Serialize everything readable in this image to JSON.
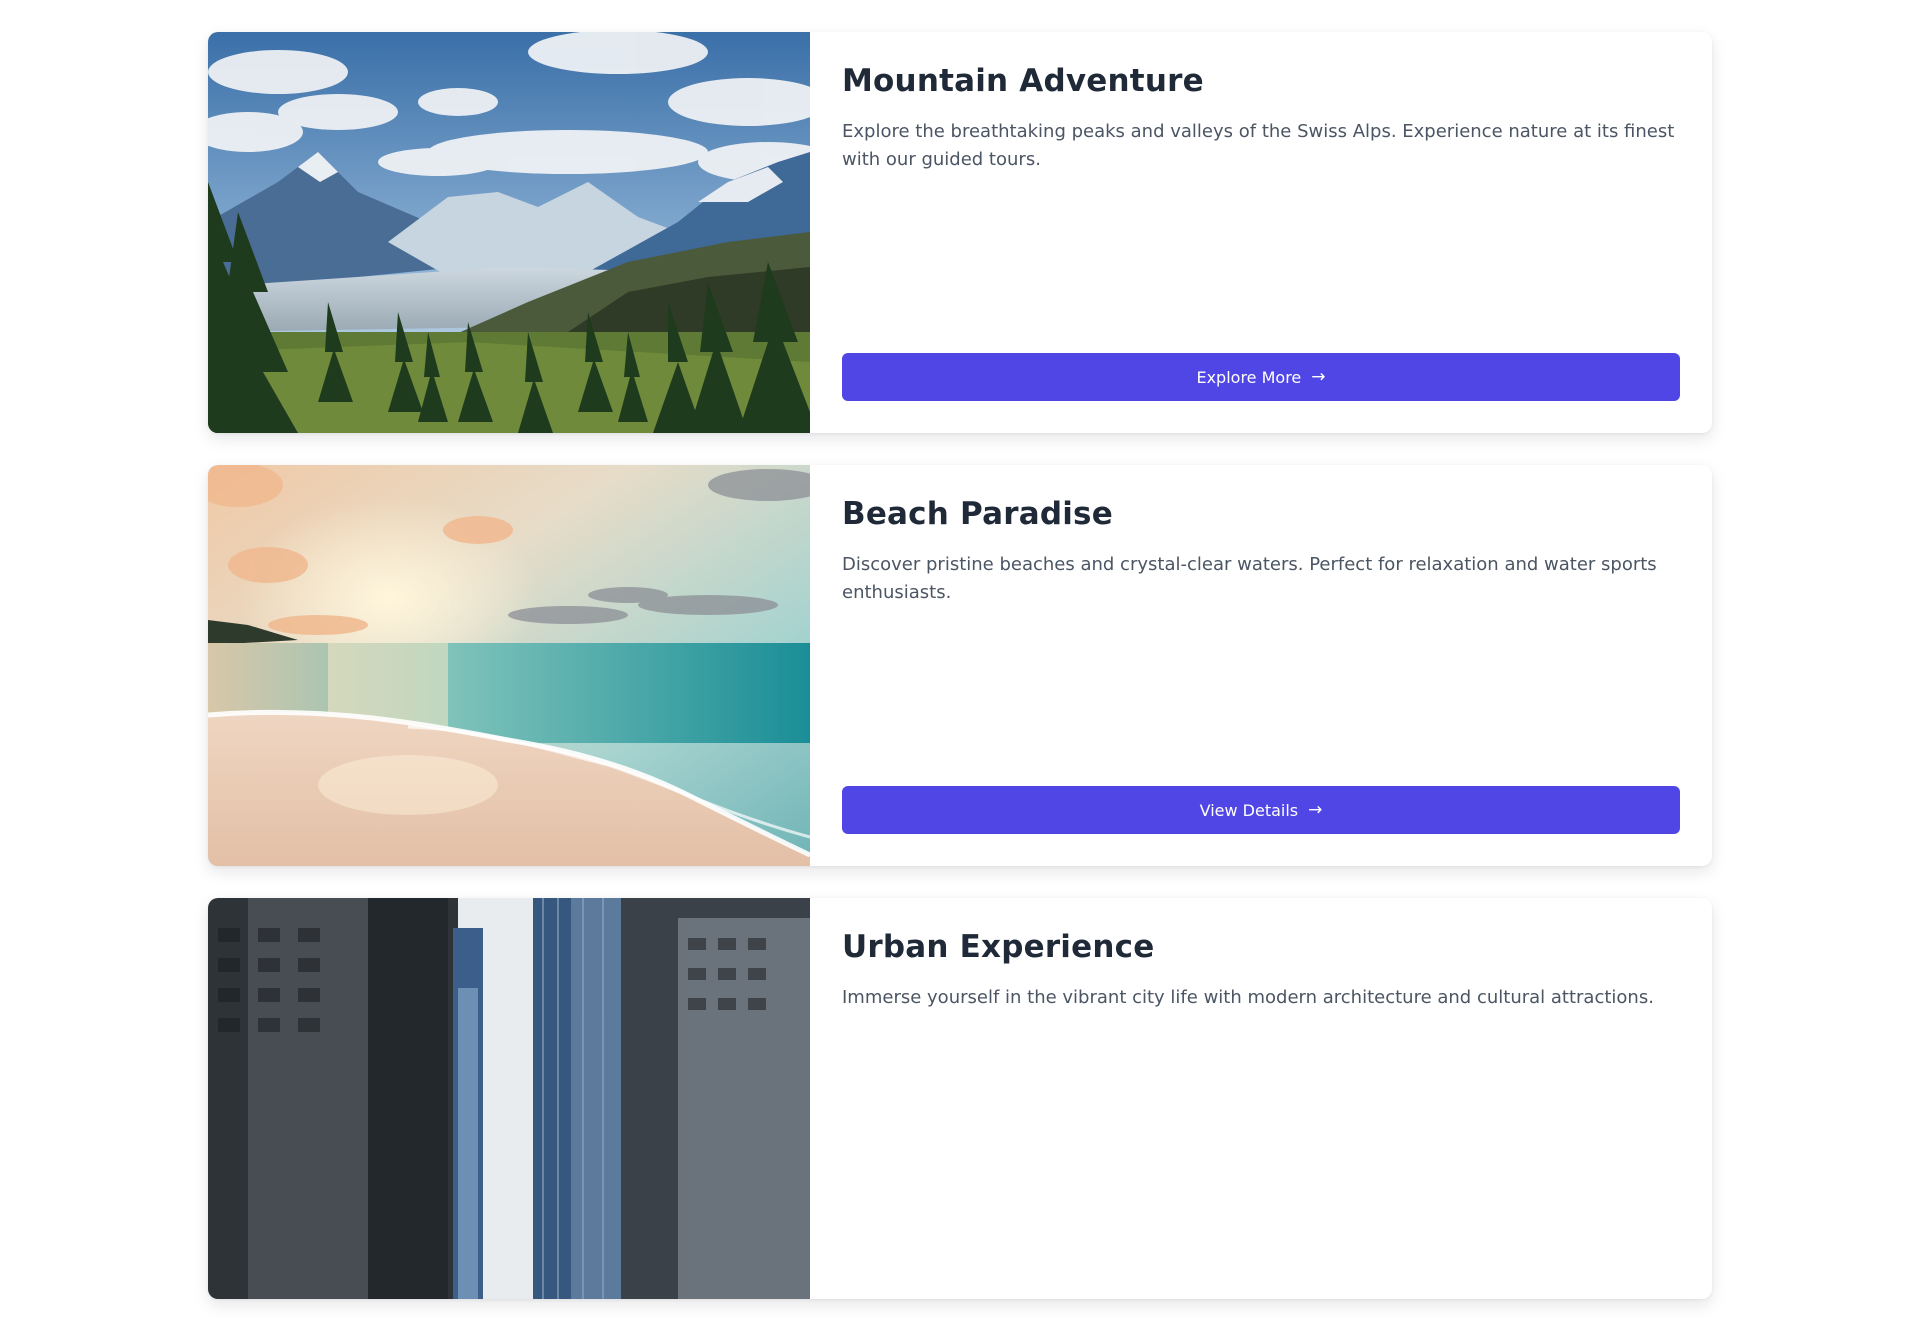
{
  "cards": [
    {
      "title": "Mountain Adventure",
      "description": "Explore the breathtaking peaks and valleys of the Swiss Alps. Experience nature at its finest with our guided tours.",
      "button_label": "Explore More",
      "button_icon": "arrow-right-icon"
    },
    {
      "title": "Beach Paradise",
      "description": "Discover pristine beaches and crystal-clear waters. Perfect for relaxation and water sports enthusiasts.",
      "button_label": "View Details",
      "button_icon": "arrow-right-icon"
    },
    {
      "title": "Urban Experience",
      "description": "Immerse yourself in the vibrant city life with modern architecture and cultural attractions."
    }
  ],
  "colors": {
    "accent": "#4f46e5",
    "title": "#1f2937",
    "body_text": "#4b5563"
  }
}
